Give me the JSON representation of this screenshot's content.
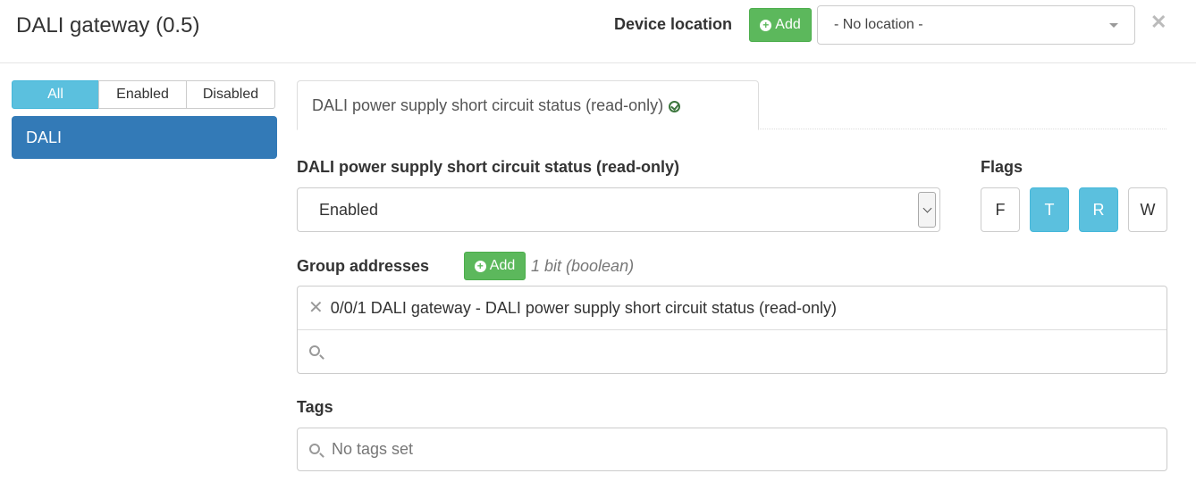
{
  "header": {
    "title": "DALI gateway (0.5)",
    "device_location_label": "Device location",
    "add_label": "Add",
    "location_value": "- No location -",
    "close_glyph": "✕"
  },
  "sidebar": {
    "filters": [
      {
        "label": "All",
        "active": true
      },
      {
        "label": "Enabled",
        "active": false
      },
      {
        "label": "Disabled",
        "active": false
      }
    ],
    "items": [
      {
        "label": "DALI",
        "active": true
      }
    ]
  },
  "main": {
    "tab_label": "DALI power supply short circuit status (read-only)",
    "status_label": "DALI power supply short circuit status (read-only)",
    "status_value": "Enabled",
    "flags_label": "Flags",
    "flags": [
      {
        "label": "F",
        "on": false
      },
      {
        "label": "T",
        "on": true
      },
      {
        "label": "R",
        "on": true
      },
      {
        "label": "W",
        "on": false
      }
    ],
    "group_addresses_label": "Group addresses",
    "group_add_label": "Add",
    "group_hint": "1 bit (boolean)",
    "group_addresses": [
      "0/0/1 DALI gateway - DALI power supply short circuit status (read-only)"
    ],
    "remove_glyph": "✕",
    "tags_label": "Tags",
    "tags_placeholder": "No tags set"
  },
  "colors": {
    "primary": "#337ab7",
    "info": "#5bc0de",
    "success": "#5cb85c",
    "ok_check": "#3c763d"
  },
  "icons": [
    "plus-circle-icon",
    "caret-down-icon",
    "close-icon",
    "check-circle-icon",
    "search-icon",
    "remove-icon"
  ]
}
